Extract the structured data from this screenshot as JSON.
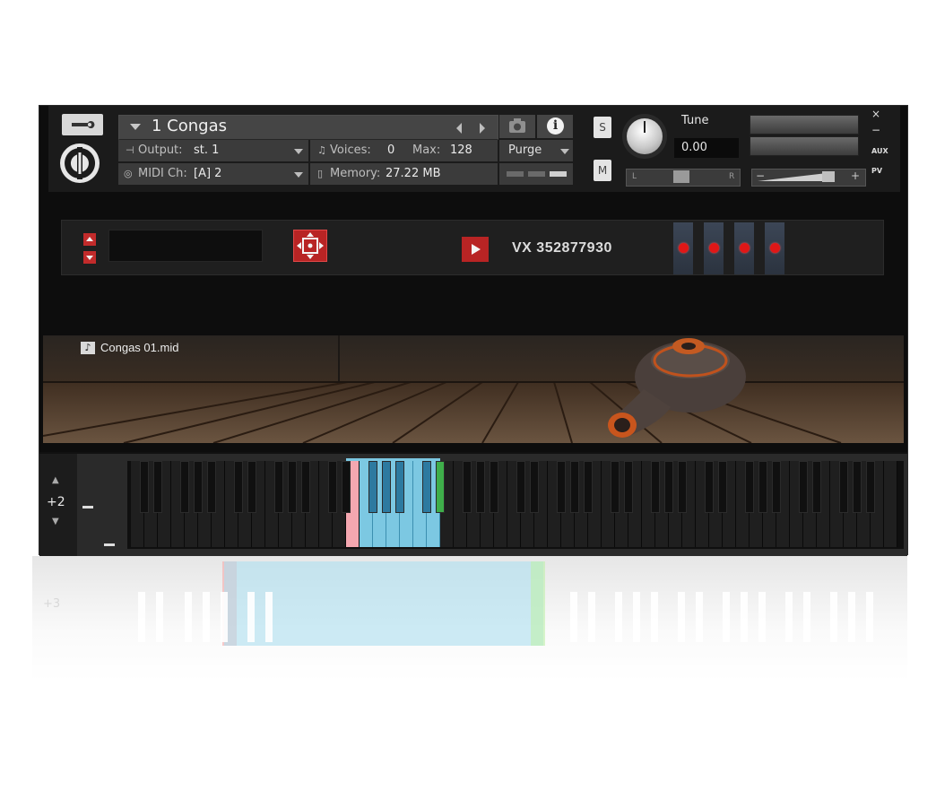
{
  "header": {
    "instrument_name": "1 Congas",
    "output_label": "Output:",
    "output_value": "st. 1",
    "midi_label": "MIDI Ch:",
    "midi_value": "[A]  2",
    "voices_label": "Voices:",
    "voices_value": "0",
    "max_label": "Max:",
    "max_value": "128",
    "memory_label": "Memory:",
    "memory_value": "27.22 MB",
    "purge_label": "Purge",
    "solo_label": "S",
    "mute_label": "M",
    "tune_label": "Tune",
    "tune_value": "0.00",
    "pan_left": "L",
    "pan_right": "R",
    "vol_minus": "−",
    "vol_plus": "+",
    "close_label": "×",
    "minimize_label": "−",
    "aux_label": "AUX",
    "pv_label": "PV",
    "info_label": "i"
  },
  "controls": {
    "pattern_name": "VX 352877930",
    "fader_count": 4
  },
  "stage": {
    "midi_file": "Congas 01.mid"
  },
  "keyboard": {
    "octave_shift": "+2",
    "reflection_shift": "+3",
    "colors": {
      "keyswitch_red": "#f4a7b0",
      "mapped_blue": "#7cc8e2",
      "mapped_blue_black": "#2d7aa0",
      "range_green": "#3fae4a",
      "accent_red": "#c22b2b"
    }
  }
}
